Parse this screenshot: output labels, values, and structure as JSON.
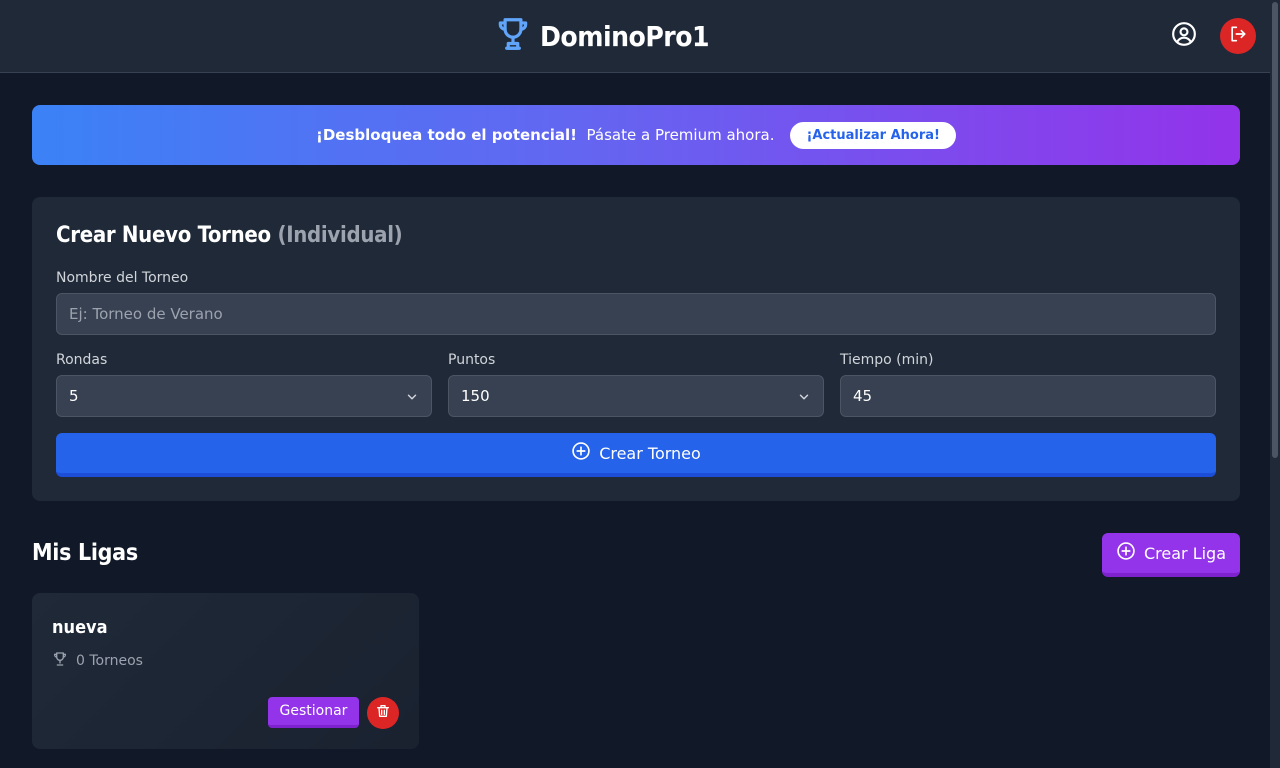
{
  "header": {
    "title": "DominoPro1",
    "icons": {
      "brand": "trophy-icon",
      "profile": "user-circle-icon",
      "logout": "logout-icon"
    }
  },
  "banner": {
    "headline": "¡Desbloquea todo el potencial!",
    "message": "Pásate a Premium ahora.",
    "cta_label": "¡Actualizar Ahora!"
  },
  "create_tournament": {
    "title": "Crear Nuevo Torneo",
    "subtitle": "(Individual)",
    "name_label": "Nombre del Torneo",
    "name_placeholder": "Ej: Torneo de Verano",
    "name_value": "",
    "rounds_label": "Rondas",
    "rounds_value": "5",
    "points_label": "Puntos",
    "points_value": "150",
    "time_label": "Tiempo (min)",
    "time_value": "45",
    "submit_label": "Crear Torneo"
  },
  "leagues": {
    "title": "Mis Ligas",
    "create_label": "Crear Liga",
    "items": [
      {
        "name": "nueva",
        "tournaments": "0 Torneos",
        "manage_label": "Gestionar"
      }
    ]
  },
  "colors": {
    "background": "#111827",
    "surface": "#1f2937",
    "primary": "#2563eb",
    "accent": "#9333ea",
    "danger": "#dc2626",
    "brand_icon": "#60a5fa"
  }
}
